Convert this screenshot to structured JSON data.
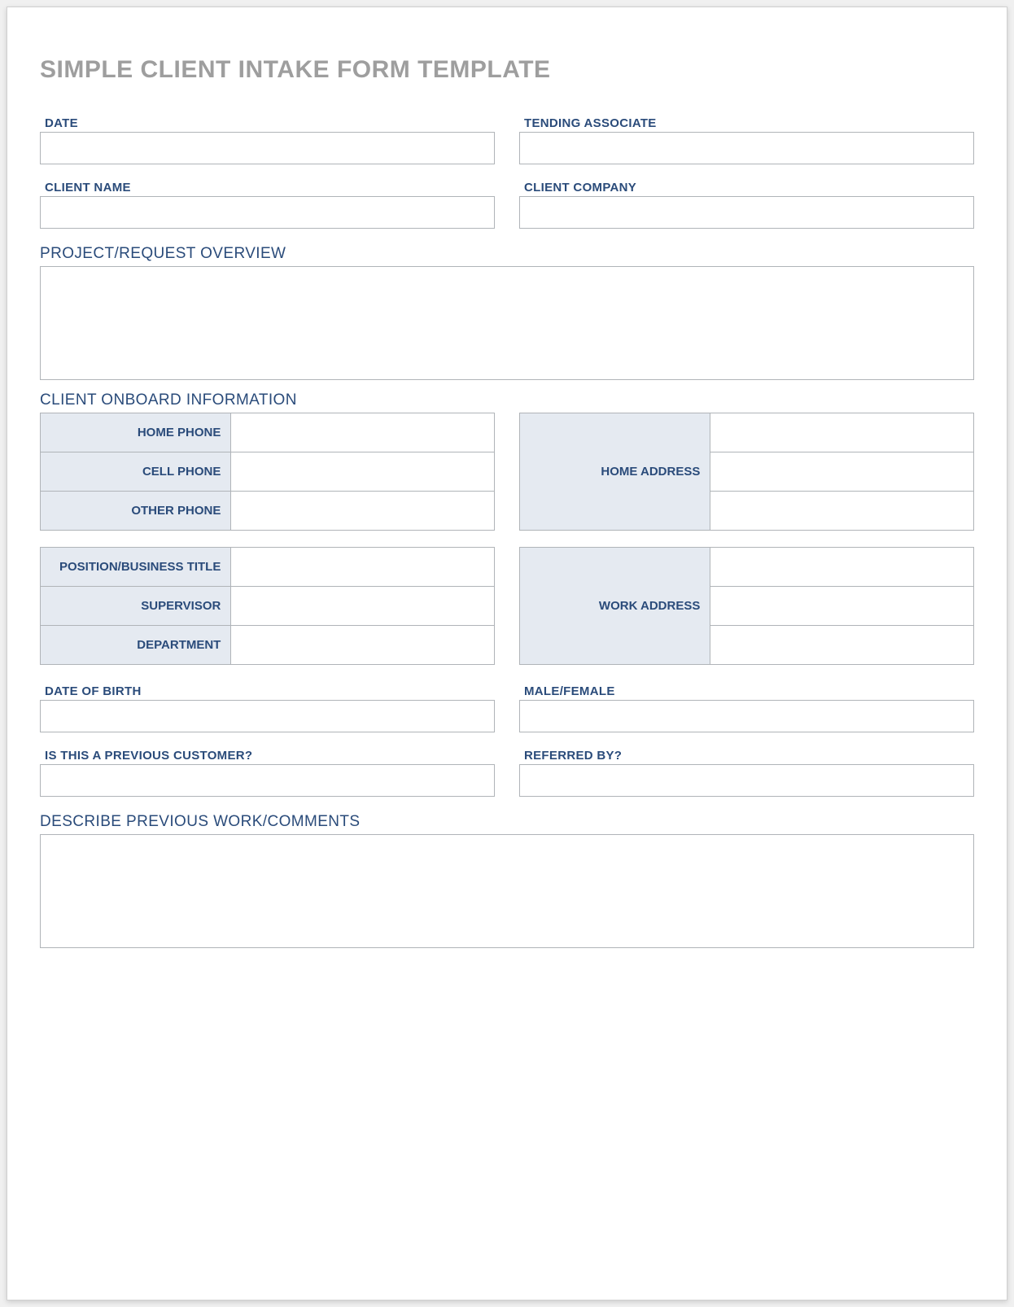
{
  "title": "SIMPLE CLIENT INTAKE FORM TEMPLATE",
  "fields": {
    "date_label": "DATE",
    "date_value": "",
    "tending_associate_label": "TENDING ASSOCIATE",
    "tending_associate_value": "",
    "client_name_label": "CLIENT NAME",
    "client_name_value": "",
    "client_company_label": "CLIENT COMPANY",
    "client_company_value": ""
  },
  "sections": {
    "project_overview_label": "PROJECT/REQUEST OVERVIEW",
    "project_overview_value": "",
    "client_onboard_label": "CLIENT ONBOARD INFORMATION",
    "describe_previous_label": "DESCRIBE PREVIOUS WORK/COMMENTS",
    "describe_previous_value": ""
  },
  "onboard": {
    "home_phone_label": "HOME PHONE",
    "home_phone_value": "",
    "cell_phone_label": "CELL PHONE",
    "cell_phone_value": "",
    "other_phone_label": "OTHER PHONE",
    "other_phone_value": "",
    "home_address_label": "HOME ADDRESS",
    "home_address_value_1": "",
    "home_address_value_2": "",
    "home_address_value_3": "",
    "position_label": "POSITION/BUSINESS TITLE",
    "position_value": "",
    "supervisor_label": "SUPERVISOR",
    "supervisor_value": "",
    "department_label": "DEPARTMENT",
    "department_value": "",
    "work_address_label": "WORK ADDRESS",
    "work_address_value_1": "",
    "work_address_value_2": "",
    "work_address_value_3": ""
  },
  "additional": {
    "dob_label": "DATE OF BIRTH",
    "dob_value": "",
    "gender_label": "MALE/FEMALE",
    "gender_value": "",
    "previous_customer_label": "IS THIS A PREVIOUS CUSTOMER?",
    "previous_customer_value": "",
    "referred_by_label": "REFERRED BY?",
    "referred_by_value": ""
  }
}
